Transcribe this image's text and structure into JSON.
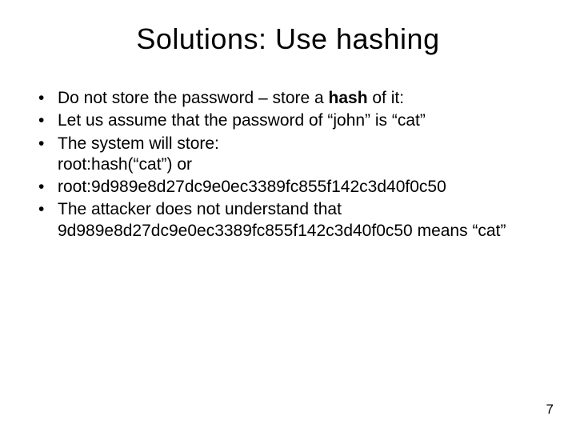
{
  "title": "Solutions: Use hashing",
  "bullets": [
    {
      "pre": "Do not store the password – store a ",
      "strong": "hash",
      "post": " of it:"
    },
    {
      "text": "Let us assume that the password of “john” is “cat”"
    },
    {
      "text": "The system will store:\nroot:hash(“cat”)  or"
    },
    {
      "text": "root:9d989e8d27dc9e0ec3389fc855f142c3d40f0c50"
    },
    {
      "text": "The attacker does not understand that 9d989e8d27dc9e0ec3389fc855f142c3d40f0c50 means “cat”"
    }
  ],
  "page_number": "7"
}
